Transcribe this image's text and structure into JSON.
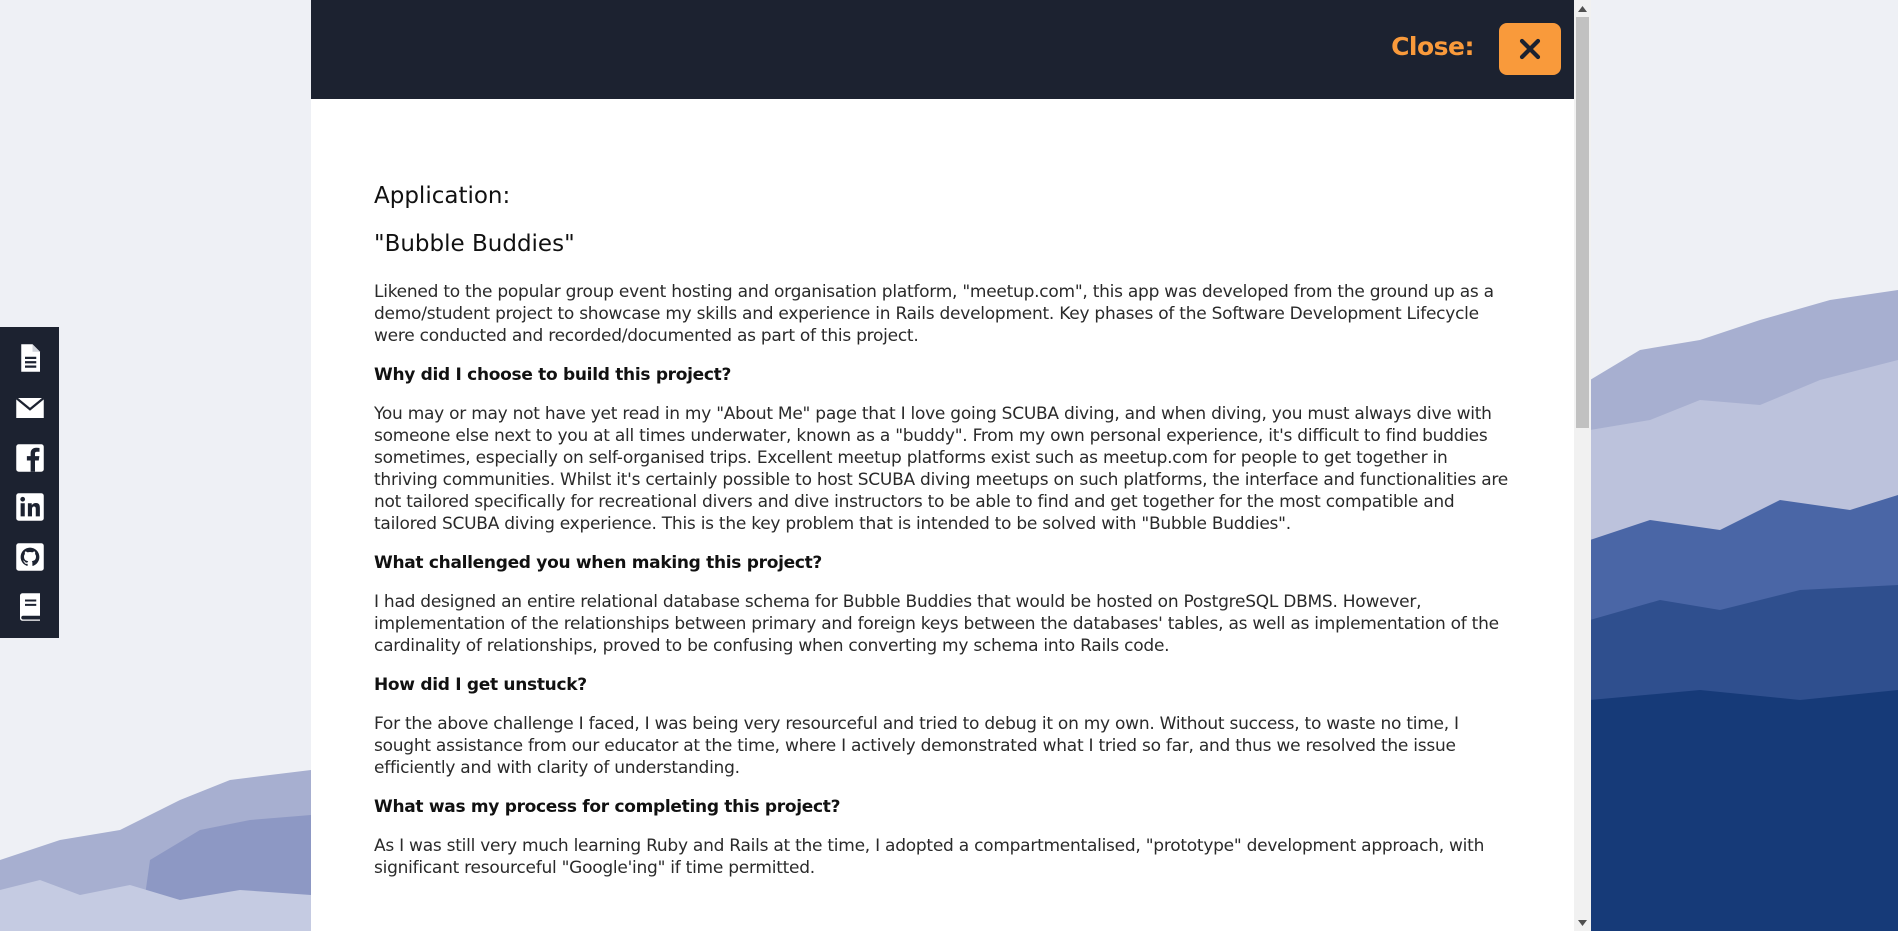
{
  "modal": {
    "close_label": "Close:",
    "close_icon": "x-icon"
  },
  "content": {
    "app_label": "Application:",
    "app_name": "\"Bubble Buddies\"",
    "intro": "Likened to the popular group event hosting and organisation platform, \"meetup.com\", this app was developed from the ground up as a demo/student project to showcase my skills and experience in Rails development. Key phases of the Software Development Lifecycle were conducted and recorded/documented as part of this project.",
    "sections": [
      {
        "heading": "Why did I choose to build this project?",
        "body": "You may or may not have yet read in my \"About Me\" page that I love going SCUBA diving, and when diving, you must always dive with someone else next to you at all times underwater, known as a \"buddy\". From my own personal experience, it's difficult to find buddies sometimes, especially on self-organised trips. Excellent meetup platforms exist such as meetup.com for people to get together in thriving communities. Whilst it's certainly possible to host SCUBA diving meetups on such platforms, the interface and functionalities are not tailored specifically for recreational divers and dive instructors to be able to find and get together for the most compatible and tailored SCUBA diving experience. This is the key problem that is intended to be solved with \"Bubble Buddies\"."
      },
      {
        "heading": "What challenged you when making this project?",
        "body": "I had designed an entire relational database schema for Bubble Buddies that would be hosted on PostgreSQL DBMS. However, implementation of the relationships between primary and foreign keys between the databases' tables, as well as implementation of the cardinality of relationships, proved to be confusing when converting my schema into Rails code."
      },
      {
        "heading": "How did I get unstuck?",
        "body": "For the above challenge I faced, I was being very resourceful and tried to debug it on my own. Without success, to waste no time, I sought assistance from our educator at the time, where I actively demonstrated what I tried so far, and thus we resolved the issue efficiently and with clarity of understanding."
      },
      {
        "heading": "What was my process for completing this project?",
        "body": "As I was still very much learning Ruby and Rails at the time, I adopted a compartmentalised, \"prototype\" development approach, with significant resourceful \"Google'ing\" if time permitted."
      }
    ]
  },
  "sidebar": {
    "items": [
      {
        "icon": "document-icon"
      },
      {
        "icon": "envelope-icon"
      },
      {
        "icon": "facebook-icon"
      },
      {
        "icon": "linkedin-icon"
      },
      {
        "icon": "github-icon"
      },
      {
        "icon": "book-icon"
      }
    ]
  },
  "colors": {
    "header_bg": "#1c2230",
    "accent": "#f99a3b",
    "background": "#eef0f5",
    "landscape_light": "#a7afd0",
    "landscape_mid": "#2f4f8e",
    "landscape_dark": "#163a78"
  }
}
